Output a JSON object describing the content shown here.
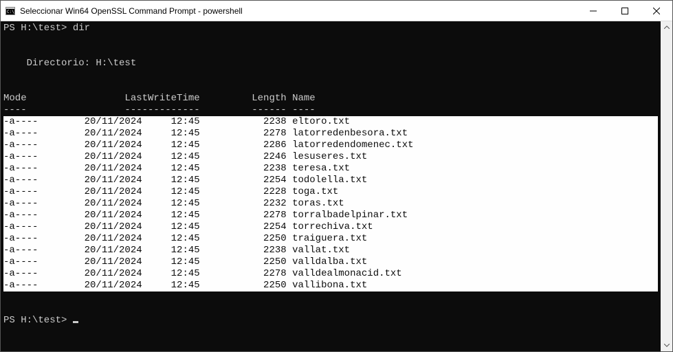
{
  "window": {
    "title": "Seleccionar Win64 OpenSSL Command Prompt - powershell"
  },
  "terminal": {
    "prompt1": "PS H:\\test> ",
    "cmd": "dir",
    "blank1": "",
    "blank2": "",
    "dirline": "    Directorio: H:\\test",
    "blank3": "",
    "blank4": "",
    "header": "Mode                 LastWriteTime         Length Name",
    "divider": "----                 -------------         ------ ----",
    "rows": [
      {
        "mode": "-a----",
        "date": "20/11/2024",
        "time": "12:45",
        "length": "2238",
        "name": "eltoro.txt"
      },
      {
        "mode": "-a----",
        "date": "20/11/2024",
        "time": "12:45",
        "length": "2278",
        "name": "latorredenbesora.txt"
      },
      {
        "mode": "-a----",
        "date": "20/11/2024",
        "time": "12:45",
        "length": "2286",
        "name": "latorredendomenec.txt"
      },
      {
        "mode": "-a----",
        "date": "20/11/2024",
        "time": "12:45",
        "length": "2246",
        "name": "lesuseres.txt"
      },
      {
        "mode": "-a----",
        "date": "20/11/2024",
        "time": "12:45",
        "length": "2238",
        "name": "teresa.txt"
      },
      {
        "mode": "-a----",
        "date": "20/11/2024",
        "time": "12:45",
        "length": "2254",
        "name": "todolella.txt"
      },
      {
        "mode": "-a----",
        "date": "20/11/2024",
        "time": "12:45",
        "length": "2228",
        "name": "toga.txt"
      },
      {
        "mode": "-a----",
        "date": "20/11/2024",
        "time": "12:45",
        "length": "2232",
        "name": "toras.txt"
      },
      {
        "mode": "-a----",
        "date": "20/11/2024",
        "time": "12:45",
        "length": "2278",
        "name": "torralbadelpinar.txt"
      },
      {
        "mode": "-a----",
        "date": "20/11/2024",
        "time": "12:45",
        "length": "2254",
        "name": "torrechiva.txt"
      },
      {
        "mode": "-a----",
        "date": "20/11/2024",
        "time": "12:45",
        "length": "2250",
        "name": "traiguera.txt"
      },
      {
        "mode": "-a----",
        "date": "20/11/2024",
        "time": "12:45",
        "length": "2238",
        "name": "vallat.txt"
      },
      {
        "mode": "-a----",
        "date": "20/11/2024",
        "time": "12:45",
        "length": "2250",
        "name": "valldalba.txt"
      },
      {
        "mode": "-a----",
        "date": "20/11/2024",
        "time": "12:45",
        "length": "2278",
        "name": "valldealmonacid.txt"
      },
      {
        "mode": "-a----",
        "date": "20/11/2024",
        "time": "12:45",
        "length": "2250",
        "name": "vallibona.txt"
      }
    ],
    "blank5": "",
    "blank6": "",
    "prompt2": "PS H:\\test> "
  }
}
